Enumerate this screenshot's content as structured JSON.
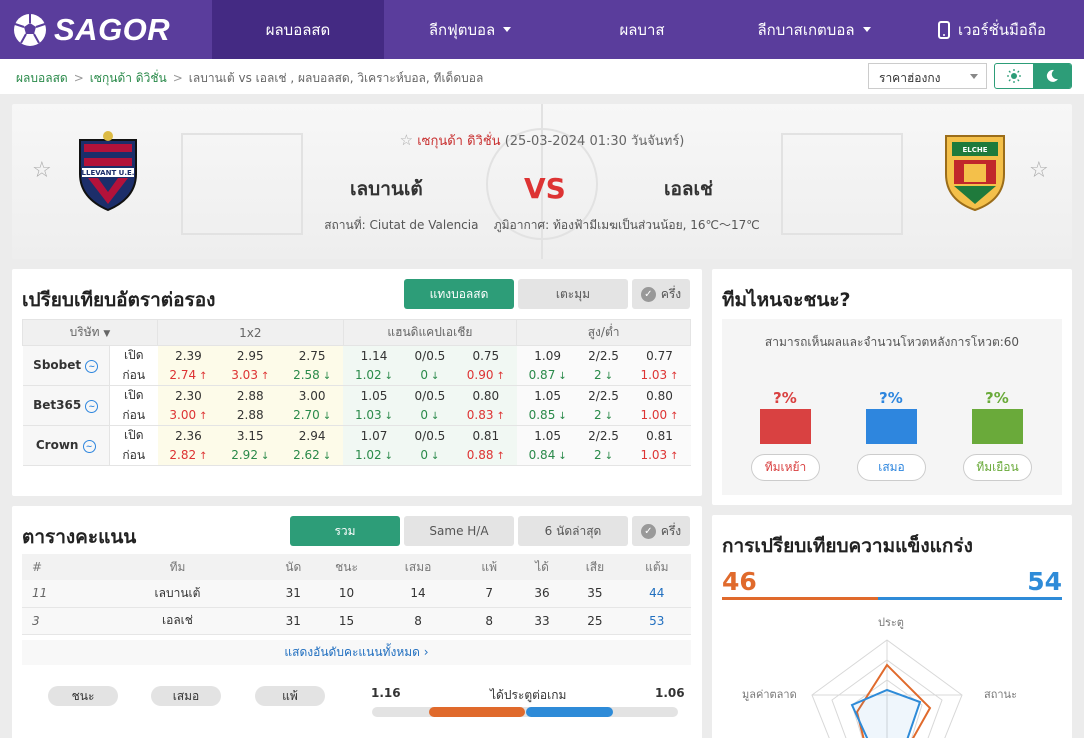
{
  "nav": {
    "logo": "SAGOR",
    "items": [
      "ผลบอลสด",
      "ลีกฟุตบอล",
      "ผลบาส",
      "ลีกบาสเกตบอล",
      "เวอร์ชั่นมือถือ"
    ]
  },
  "breadcrumb": [
    "ผลบอลสด",
    "เซกุนด้า ดิวิชั่น",
    "เลบานเต้ vs เอลเช่ ,  ผลบอลสด,  วิเคราะห์บอล,  ทีเด็ดบอล"
  ],
  "odds_format": "ราคาฮ่องกง",
  "match": {
    "league": "เซกุนด้า ดิวิชั่น",
    "datetime": "(25-03-2024 01:30 วันจันทร์)",
    "home": "เลบานเต้",
    "away": "เอลเช่",
    "vs": "VS",
    "venue": "สถานที่: Ciutat de Valencia",
    "weather": "ภูมิอากาศ: ท้องฟ้ามีเมฆเป็นส่วนน้อย, 16℃～17℃",
    "home_logo_text": "LLEVANT U.E.",
    "away_logo_text": "ELCHE"
  },
  "odds": {
    "title": "เปรียบเทียบอัตราต่อรอง",
    "tabs": [
      "แทงบอลสด",
      "เตะมุม",
      "ครึ่ง"
    ],
    "headers": [
      "บริษัท",
      "1x2",
      "แฮนดิแคปเอเชีย",
      "สูง/ต่ำ"
    ],
    "row_labels": [
      "เปิด",
      "ก่อน"
    ],
    "bookmakers": [
      {
        "name": "Sbobet",
        "open": [
          "2.39",
          "2.95",
          "2.75",
          "1.14",
          "0/0.5",
          "0.75",
          "1.09",
          "2/2.5",
          "0.77"
        ],
        "prev": [
          [
            "2.74",
            "up"
          ],
          [
            "3.03",
            "up"
          ],
          [
            "2.58",
            "dn"
          ],
          [
            "1.02",
            "dn"
          ],
          [
            "0",
            "dn"
          ],
          [
            "0.90",
            "up"
          ],
          [
            "0.87",
            "dn"
          ],
          [
            "2",
            "dn"
          ],
          [
            "1.03",
            "up"
          ]
        ]
      },
      {
        "name": "Bet365",
        "open": [
          "2.30",
          "2.88",
          "3.00",
          "1.05",
          "0/0.5",
          "0.80",
          "1.05",
          "2/2.5",
          "0.80"
        ],
        "prev": [
          [
            "3.00",
            "up"
          ],
          [
            "2.88",
            ""
          ],
          [
            "2.70",
            "dn"
          ],
          [
            "1.03",
            "dn"
          ],
          [
            "0",
            "dn"
          ],
          [
            "0.83",
            "up"
          ],
          [
            "0.85",
            "dn"
          ],
          [
            "2",
            "dn"
          ],
          [
            "1.00",
            "up"
          ]
        ]
      },
      {
        "name": "Crown",
        "open": [
          "2.36",
          "3.15",
          "2.94",
          "1.07",
          "0/0.5",
          "0.81",
          "1.05",
          "2/2.5",
          "0.81"
        ],
        "prev": [
          [
            "2.82",
            "up"
          ],
          [
            "2.92",
            "dn"
          ],
          [
            "2.62",
            "dn"
          ],
          [
            "1.02",
            "dn"
          ],
          [
            "0",
            "dn"
          ],
          [
            "0.88",
            "up"
          ],
          [
            "0.84",
            "dn"
          ],
          [
            "2",
            "dn"
          ],
          [
            "1.03",
            "up"
          ]
        ]
      }
    ]
  },
  "standings": {
    "title": "ตารางคะแนน",
    "tabs": [
      "รวม",
      "Same H/A",
      "6 นัดล่าสุด",
      "ครึ่ง"
    ],
    "headers": [
      "#",
      "ทีม",
      "นัด",
      "ชนะ",
      "เสมอ",
      "แพ้",
      "ได้",
      "เสีย",
      "แต้ม"
    ],
    "rows": [
      [
        "11",
        "เลบานเต้",
        "31",
        "10",
        "14",
        "7",
        "36",
        "35",
        "44"
      ],
      [
        "3",
        "เอลเช่",
        "31",
        "15",
        "8",
        "8",
        "33",
        "25",
        "53"
      ]
    ],
    "more": "แสดงอันดับคะแนนทั้งหมด"
  },
  "form": {
    "pills": [
      "ชนะ",
      "เสมอ",
      "แพ้"
    ],
    "goals_home": "1.16",
    "goals_label": "ได้ประตูต่อเกม",
    "goals_away": "1.06",
    "goals_home_value": 1.16,
    "goals_away_value": 1.06
  },
  "vote": {
    "title": "ทีมไหนจะชนะ?",
    "note": "สามารถเห็นผลและจำนวนโหวตหลังการโหวต:60",
    "options": [
      {
        "pct": "?%",
        "label": "ทีมเหย้า",
        "color": "#d94141"
      },
      {
        "pct": "?%",
        "label": "เสมอ",
        "color": "#2e86de"
      },
      {
        "pct": "?%",
        "label": "ทีมเยือน",
        "color": "#6aaa3a"
      }
    ]
  },
  "strength": {
    "title": "การเปรียบเทียบความแข็งแกร่ง",
    "home": "46",
    "away": "54",
    "home_value": 46,
    "away_value": 54,
    "axes": [
      "ประตู",
      "สถานะ",
      "มูลค่าตลาด"
    ]
  },
  "colors": {
    "nav": "#5a3d9c",
    "green": "#2d9d78",
    "home": "#e06a2c",
    "away": "#2e8bd8"
  }
}
